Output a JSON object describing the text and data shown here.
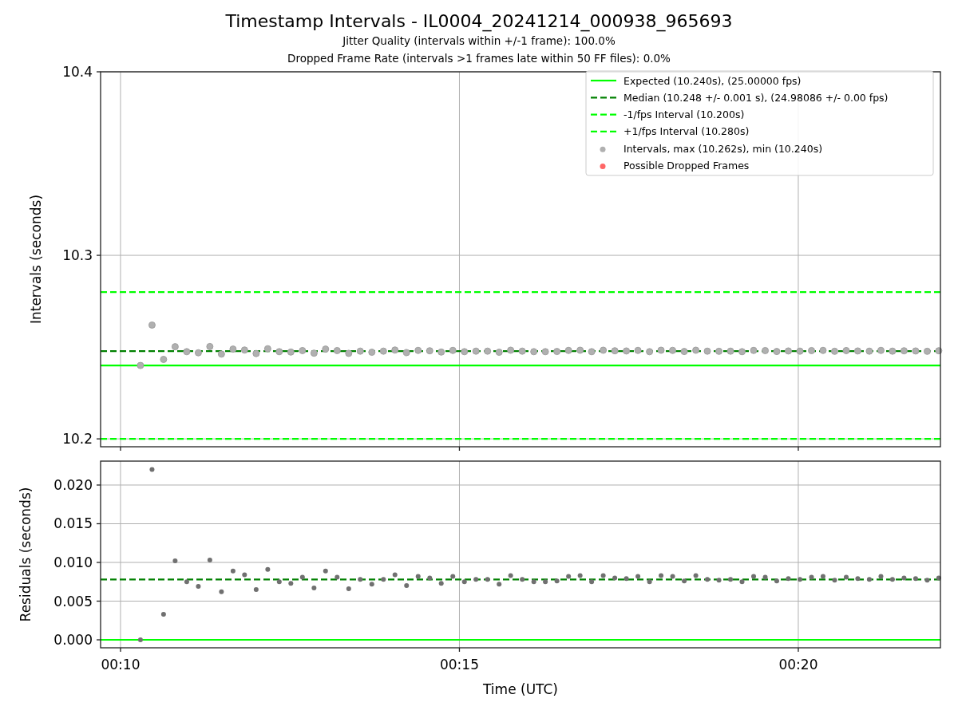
{
  "figure": {
    "title": "Timestamp Intervals - IL0004_20241214_000938_965693",
    "subtitles": [
      "Jitter Quality (intervals within +/-1 frame): 100.0%",
      "Dropped Frame Rate (intervals >1 frames late within 50 FF files): 0.0%"
    ]
  },
  "panels": [
    {
      "chart_data": {
        "type": "scatter",
        "ylabel": "Intervals (seconds)",
        "xlim": [
          9.706,
          22.097
        ],
        "ylim": [
          10.1957,
          10.4
        ],
        "yticks": [
          {
            "value": 10.2,
            "label": "10.2"
          },
          {
            "value": 10.3,
            "label": "10.3"
          },
          {
            "value": 10.4,
            "label": "10.4"
          }
        ],
        "x": [
          10.294,
          10.465,
          10.635,
          10.806,
          10.977,
          11.148,
          11.318,
          11.489,
          11.66,
          11.83,
          12.001,
          12.172,
          12.342,
          12.513,
          12.684,
          12.855,
          13.025,
          13.196,
          13.367,
          13.537,
          13.708,
          13.879,
          14.049,
          14.22,
          14.391,
          14.562,
          14.732,
          14.903,
          15.074,
          15.244,
          15.415,
          15.586,
          15.756,
          15.927,
          16.098,
          16.268,
          16.439,
          16.61,
          16.781,
          16.951,
          17.122,
          17.293,
          17.463,
          17.634,
          17.805,
          17.975,
          18.146,
          18.317,
          18.488,
          18.658,
          18.829,
          19.0,
          19.17,
          19.341,
          19.512,
          19.682,
          19.853,
          20.024,
          20.195,
          20.365,
          20.536,
          20.707,
          20.877,
          21.048,
          21.219,
          21.389,
          21.56,
          21.731,
          21.902,
          22.072
        ],
        "grid": true,
        "legend": true,
        "ref_lines": [
          {
            "label": "Expected (10.240s), (25.00000 fps)",
            "color": "#00ff00",
            "axis": "y",
            "value": 10.24
          },
          {
            "label": "Median (10.248 +/- 0.001 s), (24.98086 +/- 0.00 fps)",
            "color": "#008000",
            "axis": "y",
            "value": 10.2478
          },
          {
            "label": "-1/fps Interval (10.200s)",
            "color": "#00ff00",
            "axis": "y",
            "value": 10.2
          },
          {
            "label": "+1/fps Interval (10.280s)",
            "color": "#00ff00",
            "axis": "y",
            "value": 10.28
          }
        ],
        "series": [
          {
            "name": "Intervals, max (10.262s), min (10.240s)",
            "color": "#b0b0b0",
            "values": [
              10.24,
              10.262,
              10.2433,
              10.2502,
              10.2475,
              10.2469,
              10.2503,
              10.2462,
              10.2489,
              10.2484,
              10.2465,
              10.2491,
              10.2475,
              10.2473,
              10.2481,
              10.2467,
              10.2489,
              10.2481,
              10.2466,
              10.2478,
              10.2472,
              10.2478,
              10.2484,
              10.247,
              10.2482,
              10.248,
              10.2473,
              10.2482,
              10.2475,
              10.2478,
              10.2478,
              10.2472,
              10.2483,
              10.2478,
              10.2475,
              10.2475,
              10.2476,
              10.2482,
              10.2483,
              10.2475,
              10.2483,
              10.248,
              10.2479,
              10.2482,
              10.2475,
              10.2483,
              10.2482,
              10.2476,
              10.2483,
              10.2478,
              10.2477,
              10.2478,
              10.2475,
              10.2482,
              10.2481,
              10.2476,
              10.2479,
              10.2478,
              10.2481,
              10.2482,
              10.2477,
              10.2481,
              10.2479,
              10.2478,
              10.2482,
              10.2478,
              10.248,
              10.2479,
              10.2477,
              10.248
            ]
          },
          {
            "name": "Possible Dropped Frames",
            "color": "#ff6666",
            "values": [
              null,
              null,
              null,
              null,
              null,
              null,
              null,
              null,
              null,
              null,
              null,
              null,
              null,
              null,
              null,
              null,
              null,
              null,
              null,
              null,
              null,
              null,
              null,
              null,
              null,
              null,
              null,
              null,
              null,
              null,
              null,
              null,
              null,
              null,
              null,
              null,
              null,
              null,
              null,
              null,
              null,
              null,
              null,
              null,
              null,
              null,
              null,
              null,
              null,
              null,
              null,
              null,
              null,
              null,
              null,
              null,
              null,
              null,
              null,
              null,
              null,
              null,
              null,
              null,
              null,
              null,
              null,
              null,
              null,
              null
            ]
          }
        ]
      }
    },
    {
      "chart_data": {
        "type": "scatter",
        "xlabel": "Time (UTC)",
        "ylabel": "Residuals (seconds)",
        "xlim": [
          9.706,
          22.097
        ],
        "ylim": [
          -0.00103,
          0.02309
        ],
        "xticks": [
          {
            "value": 10,
            "label": "00:10"
          },
          {
            "value": 15,
            "label": "00:15"
          },
          {
            "value": 20,
            "label": "00:20"
          }
        ],
        "yticks": [
          {
            "value": 0,
            "label": "0.000"
          },
          {
            "value": 0.005,
            "label": "0.005"
          },
          {
            "value": 0.01,
            "label": "0.010"
          },
          {
            "value": 0.015,
            "label": "0.015"
          },
          {
            "value": 0.02,
            "label": "0.020"
          }
        ],
        "x": [
          10.294,
          10.465,
          10.635,
          10.806,
          10.977,
          11.148,
          11.318,
          11.489,
          11.66,
          11.83,
          12.001,
          12.172,
          12.342,
          12.513,
          12.684,
          12.855,
          13.025,
          13.196,
          13.367,
          13.537,
          13.708,
          13.879,
          14.049,
          14.22,
          14.391,
          14.562,
          14.732,
          14.903,
          15.074,
          15.244,
          15.415,
          15.586,
          15.756,
          15.927,
          16.098,
          16.268,
          16.439,
          16.61,
          16.781,
          16.951,
          17.122,
          17.293,
          17.463,
          17.634,
          17.805,
          17.975,
          18.146,
          18.317,
          18.488,
          18.658,
          18.829,
          19.0,
          19.17,
          19.341,
          19.512,
          19.682,
          19.853,
          20.024,
          20.195,
          20.365,
          20.536,
          20.707,
          20.877,
          21.048,
          21.219,
          21.389,
          21.56,
          21.731,
          21.902,
          22.072
        ],
        "grid": true,
        "ref_lines": [
          {
            "color": "#00ff00",
            "axis": "y",
            "value": 0
          },
          {
            "color": "#008000",
            "axis": "y",
            "value": 0.0078
          }
        ],
        "series": [
          {
            "color": "#707070",
            "values": [
              0,
              0.022,
              0.0033,
              0.0102,
              0.0075,
              0.0069,
              0.0103,
              0.0062,
              0.0089,
              0.0084,
              0.0065,
              0.0091,
              0.0075,
              0.0073,
              0.0081,
              0.0067,
              0.0089,
              0.0081,
              0.0066,
              0.0078,
              0.0072,
              0.0078,
              0.0084,
              0.007,
              0.0082,
              0.008,
              0.0073,
              0.0082,
              0.0075,
              0.0078,
              0.0078,
              0.0072,
              0.0083,
              0.0078,
              0.0075,
              0.0075,
              0.0076,
              0.0082,
              0.0083,
              0.0075,
              0.0083,
              0.008,
              0.0079,
              0.0082,
              0.0075,
              0.0083,
              0.0082,
              0.0076,
              0.0083,
              0.0078,
              0.0077,
              0.0078,
              0.0075,
              0.0082,
              0.0081,
              0.0076,
              0.0079,
              0.0078,
              0.0081,
              0.0082,
              0.0077,
              0.0081,
              0.0079,
              0.0078,
              0.0082,
              0.0078,
              0.008,
              0.0079,
              0.0077,
              0.008
            ]
          }
        ]
      }
    }
  ]
}
